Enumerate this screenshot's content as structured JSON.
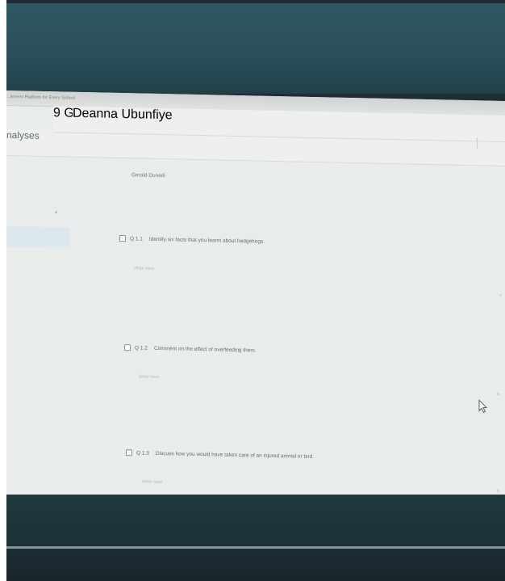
{
  "browser": {
    "tab_text": "...lement Platform for Every School"
  },
  "header": {
    "title": "nalyses",
    "crumb_1": "9 Gr",
    "crumb_2": "Deanna Ubunfiye"
  },
  "student": {
    "name": "Gerald Dunedi"
  },
  "questions": [
    {
      "number": "Q 1.1",
      "text": "Identify six facts that you learnt about hedgehogs.",
      "placeholder": "Write here"
    },
    {
      "number": "Q 1.2",
      "text": "Comment on the effect of overfeeding them.",
      "placeholder": "Write here"
    },
    {
      "number": "Q 1.3",
      "text": "Discuss how you would have taken care of an injured animal or bird.",
      "placeholder": "Write here"
    }
  ],
  "icons": {
    "checkbox": "checkbox-icon",
    "cursor": "mouse-pointer-icon"
  }
}
